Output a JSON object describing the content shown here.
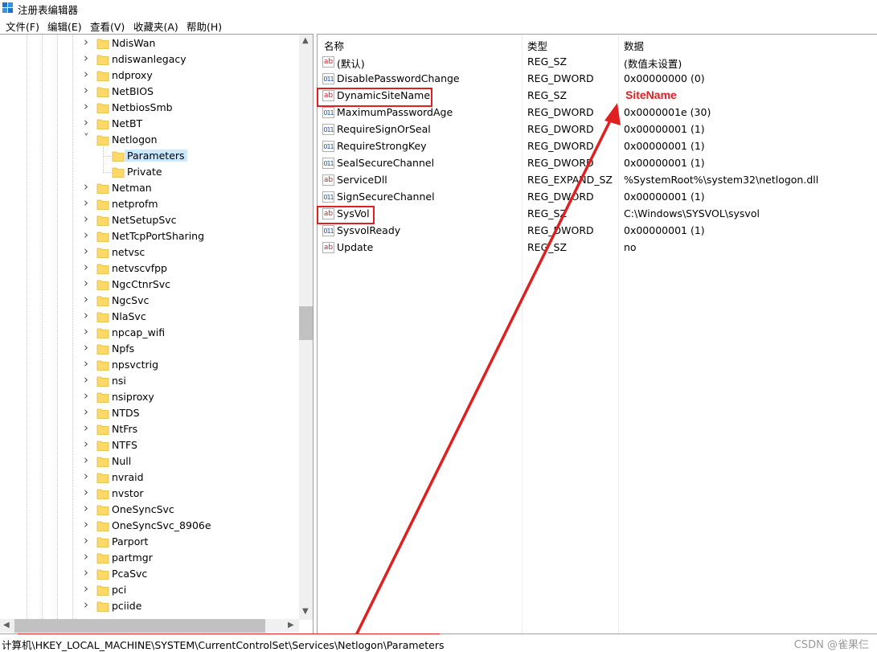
{
  "window": {
    "title": "注册表编辑器"
  },
  "menu": [
    "文件(F)",
    "编辑(E)",
    "查看(V)",
    "收藏夹(A)",
    "帮助(H)"
  ],
  "tree": {
    "items": [
      {
        "label": "NdisWan",
        "level": 1,
        "expander": "collapsed",
        "selected": false
      },
      {
        "label": "ndiswanlegacy",
        "level": 1,
        "expander": "collapsed",
        "selected": false
      },
      {
        "label": "ndproxy",
        "level": 1,
        "expander": "collapsed",
        "selected": false
      },
      {
        "label": "NetBIOS",
        "level": 1,
        "expander": "collapsed",
        "selected": false
      },
      {
        "label": "NetbiosSmb",
        "level": 1,
        "expander": "collapsed",
        "selected": false
      },
      {
        "label": "NetBT",
        "level": 1,
        "expander": "collapsed",
        "selected": false
      },
      {
        "label": "Netlogon",
        "level": 1,
        "expander": "expanded",
        "selected": false
      },
      {
        "label": "Parameters",
        "level": 2,
        "expander": "none",
        "selected": true
      },
      {
        "label": "Private",
        "level": 2,
        "expander": "none",
        "selected": false
      },
      {
        "label": "Netman",
        "level": 1,
        "expander": "collapsed",
        "selected": false
      },
      {
        "label": "netprofm",
        "level": 1,
        "expander": "collapsed",
        "selected": false
      },
      {
        "label": "NetSetupSvc",
        "level": 1,
        "expander": "collapsed",
        "selected": false
      },
      {
        "label": "NetTcpPortSharing",
        "level": 1,
        "expander": "collapsed",
        "selected": false
      },
      {
        "label": "netvsc",
        "level": 1,
        "expander": "collapsed",
        "selected": false
      },
      {
        "label": "netvscvfpp",
        "level": 1,
        "expander": "collapsed",
        "selected": false
      },
      {
        "label": "NgcCtnrSvc",
        "level": 1,
        "expander": "collapsed",
        "selected": false
      },
      {
        "label": "NgcSvc",
        "level": 1,
        "expander": "collapsed",
        "selected": false
      },
      {
        "label": "NlaSvc",
        "level": 1,
        "expander": "collapsed",
        "selected": false
      },
      {
        "label": "npcap_wifi",
        "level": 1,
        "expander": "collapsed",
        "selected": false
      },
      {
        "label": "Npfs",
        "level": 1,
        "expander": "collapsed",
        "selected": false
      },
      {
        "label": "npsvctrig",
        "level": 1,
        "expander": "collapsed",
        "selected": false
      },
      {
        "label": "nsi",
        "level": 1,
        "expander": "collapsed",
        "selected": false
      },
      {
        "label": "nsiproxy",
        "level": 1,
        "expander": "collapsed",
        "selected": false
      },
      {
        "label": "NTDS",
        "level": 1,
        "expander": "collapsed",
        "selected": false
      },
      {
        "label": "NtFrs",
        "level": 1,
        "expander": "collapsed",
        "selected": false
      },
      {
        "label": "NTFS",
        "level": 1,
        "expander": "collapsed",
        "selected": false
      },
      {
        "label": "Null",
        "level": 1,
        "expander": "collapsed",
        "selected": false
      },
      {
        "label": "nvraid",
        "level": 1,
        "expander": "collapsed",
        "selected": false
      },
      {
        "label": "nvstor",
        "level": 1,
        "expander": "collapsed",
        "selected": false
      },
      {
        "label": "OneSyncSvc",
        "level": 1,
        "expander": "collapsed",
        "selected": false
      },
      {
        "label": "OneSyncSvc_8906e",
        "level": 1,
        "expander": "collapsed",
        "selected": false
      },
      {
        "label": "Parport",
        "level": 1,
        "expander": "collapsed",
        "selected": false
      },
      {
        "label": "partmgr",
        "level": 1,
        "expander": "collapsed",
        "selected": false
      },
      {
        "label": "PcaSvc",
        "level": 1,
        "expander": "collapsed",
        "selected": false
      },
      {
        "label": "pci",
        "level": 1,
        "expander": "collapsed",
        "selected": false
      },
      {
        "label": "pciide",
        "level": 1,
        "expander": "collapsed",
        "selected": false
      }
    ]
  },
  "values": {
    "columns": [
      "名称",
      "类型",
      "数据"
    ],
    "rows": [
      {
        "name": "(默认)",
        "type": "REG_SZ",
        "data": "(数值未设置)",
        "icon": "string-value-icon"
      },
      {
        "name": "DisablePasswordChange",
        "type": "REG_DWORD",
        "data": "0x00000000 (0)",
        "icon": "binary-value-icon"
      },
      {
        "name": "DynamicSiteName",
        "type": "REG_SZ",
        "data": "",
        "icon": "string-value-icon"
      },
      {
        "name": "MaximumPasswordAge",
        "type": "REG_DWORD",
        "data": "0x0000001e (30)",
        "icon": "binary-value-icon"
      },
      {
        "name": "RequireSignOrSeal",
        "type": "REG_DWORD",
        "data": "0x00000001 (1)",
        "icon": "binary-value-icon"
      },
      {
        "name": "RequireStrongKey",
        "type": "REG_DWORD",
        "data": "0x00000001 (1)",
        "icon": "binary-value-icon"
      },
      {
        "name": "SealSecureChannel",
        "type": "REG_DWORD",
        "data": "0x00000001 (1)",
        "icon": "binary-value-icon"
      },
      {
        "name": "ServiceDll",
        "type": "REG_EXPAND_SZ",
        "data": "%SystemRoot%\\system32\\netlogon.dll",
        "icon": "string-value-icon"
      },
      {
        "name": "SignSecureChannel",
        "type": "REG_DWORD",
        "data": "0x00000001 (1)",
        "icon": "binary-value-icon"
      },
      {
        "name": "SysVol",
        "type": "REG_SZ",
        "data": "C:\\Windows\\SYSVOL\\sysvol",
        "icon": "string-value-icon"
      },
      {
        "name": "SysvolReady",
        "type": "REG_DWORD",
        "data": "0x00000001 (1)",
        "icon": "binary-value-icon"
      },
      {
        "name": "Update",
        "type": "REG_SZ",
        "data": "no",
        "icon": "string-value-icon"
      }
    ]
  },
  "annotation": {
    "label": "SiteName",
    "color": "#e02020"
  },
  "status": {
    "path": "计算机\\HKEY_LOCAL_MACHINE\\SYSTEM\\CurrentControlSet\\Services\\Netlogon\\Parameters",
    "watermark": "CSDN @雀果仨"
  }
}
